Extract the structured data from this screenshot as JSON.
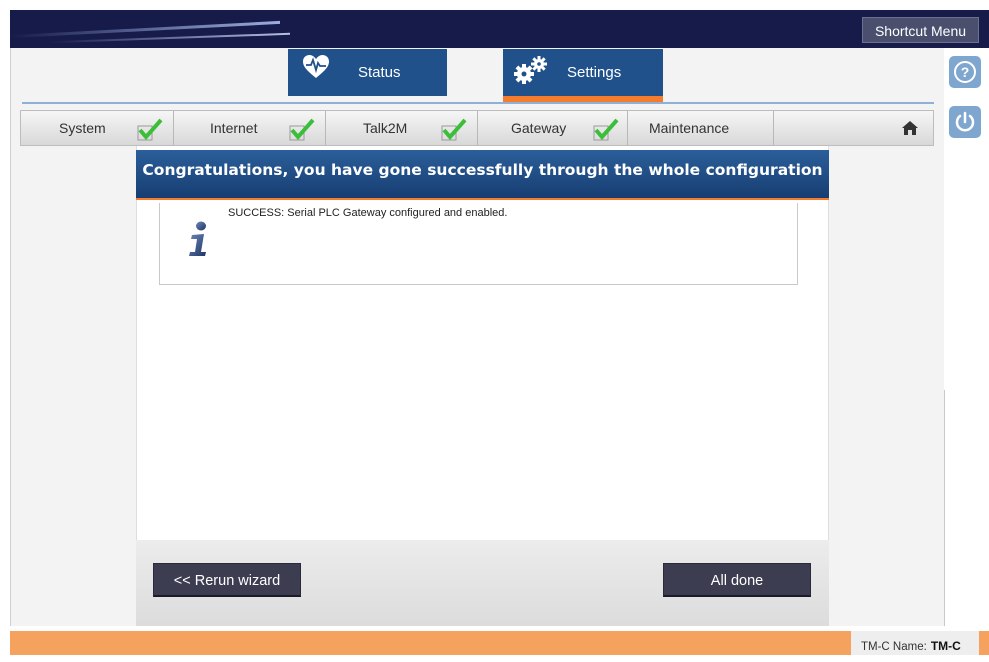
{
  "header": {
    "shortcut_menu_label": "Shortcut Menu"
  },
  "tabs": [
    {
      "label": "Status",
      "icon": "heart-icon"
    },
    {
      "label": "Settings",
      "icon": "gears-icon",
      "active": true
    }
  ],
  "steps": [
    {
      "label": "System",
      "completed": true
    },
    {
      "label": "Internet",
      "completed": true
    },
    {
      "label": "Talk2M",
      "completed": true
    },
    {
      "label": "Gateway",
      "completed": true
    },
    {
      "label": "Maintenance",
      "completed": false
    }
  ],
  "banner": {
    "title": "Congratulations, you have gone successfully through the whole configuration"
  },
  "message": {
    "text": "SUCCESS: Serial PLC Gateway configured and enabled.",
    "icon": "info-icon"
  },
  "footer_buttons": {
    "rerun_label": "<< Rerun wizard",
    "done_label": "All done"
  },
  "status_bar": {
    "name_label": "TM-C Name:",
    "name_value": "TM-C"
  },
  "colors": {
    "header_dark": "#161b4a",
    "tab_blue": "#20518a",
    "accent_orange": "#f47c2c",
    "check_green": "#3bbf3b",
    "bottom_bar": "#f5a25e"
  }
}
